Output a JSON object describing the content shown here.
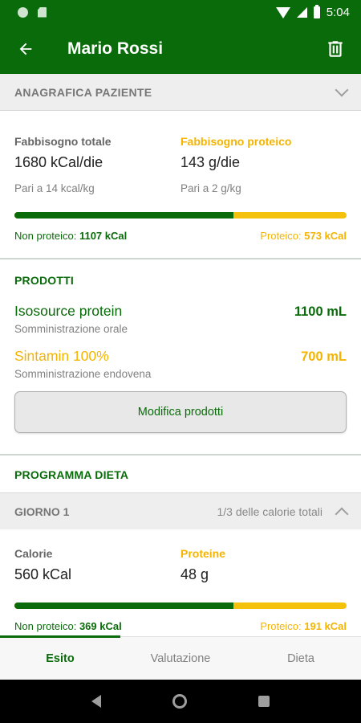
{
  "status": {
    "time": "5:04"
  },
  "app_bar": {
    "title": "Mario Rossi"
  },
  "anagrafica": {
    "header": "ANAGRAFICA PAZIENTE",
    "fabbisogno_totale_label": "Fabbisogno totale",
    "fabbisogno_totale_value": "1680 kCal/die",
    "fabbisogno_totale_note": "Pari a 14 kcal/kg",
    "fabbisogno_proteico_label": "Fabbisogno proteico",
    "fabbisogno_proteico_value": "143 g/die",
    "fabbisogno_proteico_note": "Pari a 2 g/kg",
    "bar_non_proteico_fraction": 0.659,
    "non_proteico_label": "Non proteico:",
    "non_proteico_value": "1107 kCal",
    "proteico_label": "Proteico:",
    "proteico_value": "573 kCal"
  },
  "prodotti": {
    "header": "PRODOTTI",
    "items": [
      {
        "name": "Isosource protein",
        "quantity": "1100 mL",
        "route": "Somministrazione orale"
      },
      {
        "name": "Sintamin 100%",
        "quantity": "700 mL",
        "route": "Somministrazione endovena"
      }
    ],
    "edit_button": "Modifica prodotti"
  },
  "programma": {
    "header": "PROGRAMMA DIETA",
    "day": {
      "title": "GIORNO 1",
      "info": "1/3 delle calorie totali",
      "calorie_label": "Calorie",
      "calorie_value": "560 kCal",
      "proteine_label": "Proteine",
      "proteine_value": "48 g",
      "bar_non_proteico_fraction": 0.659,
      "non_proteico_label": "Non proteico:",
      "non_proteico_value": "369 kCal",
      "proteico_label": "Proteico:",
      "proteico_value": "191 kCal"
    }
  },
  "bottom_nav": {
    "tabs": [
      "Esito",
      "Valutazione",
      "Dieta"
    ],
    "active": "Esito"
  },
  "colors": {
    "primary": "#0a6b0a",
    "accent": "#f4b400"
  },
  "icons": {
    "back": "arrow-left-icon",
    "trash": "trash-icon"
  }
}
